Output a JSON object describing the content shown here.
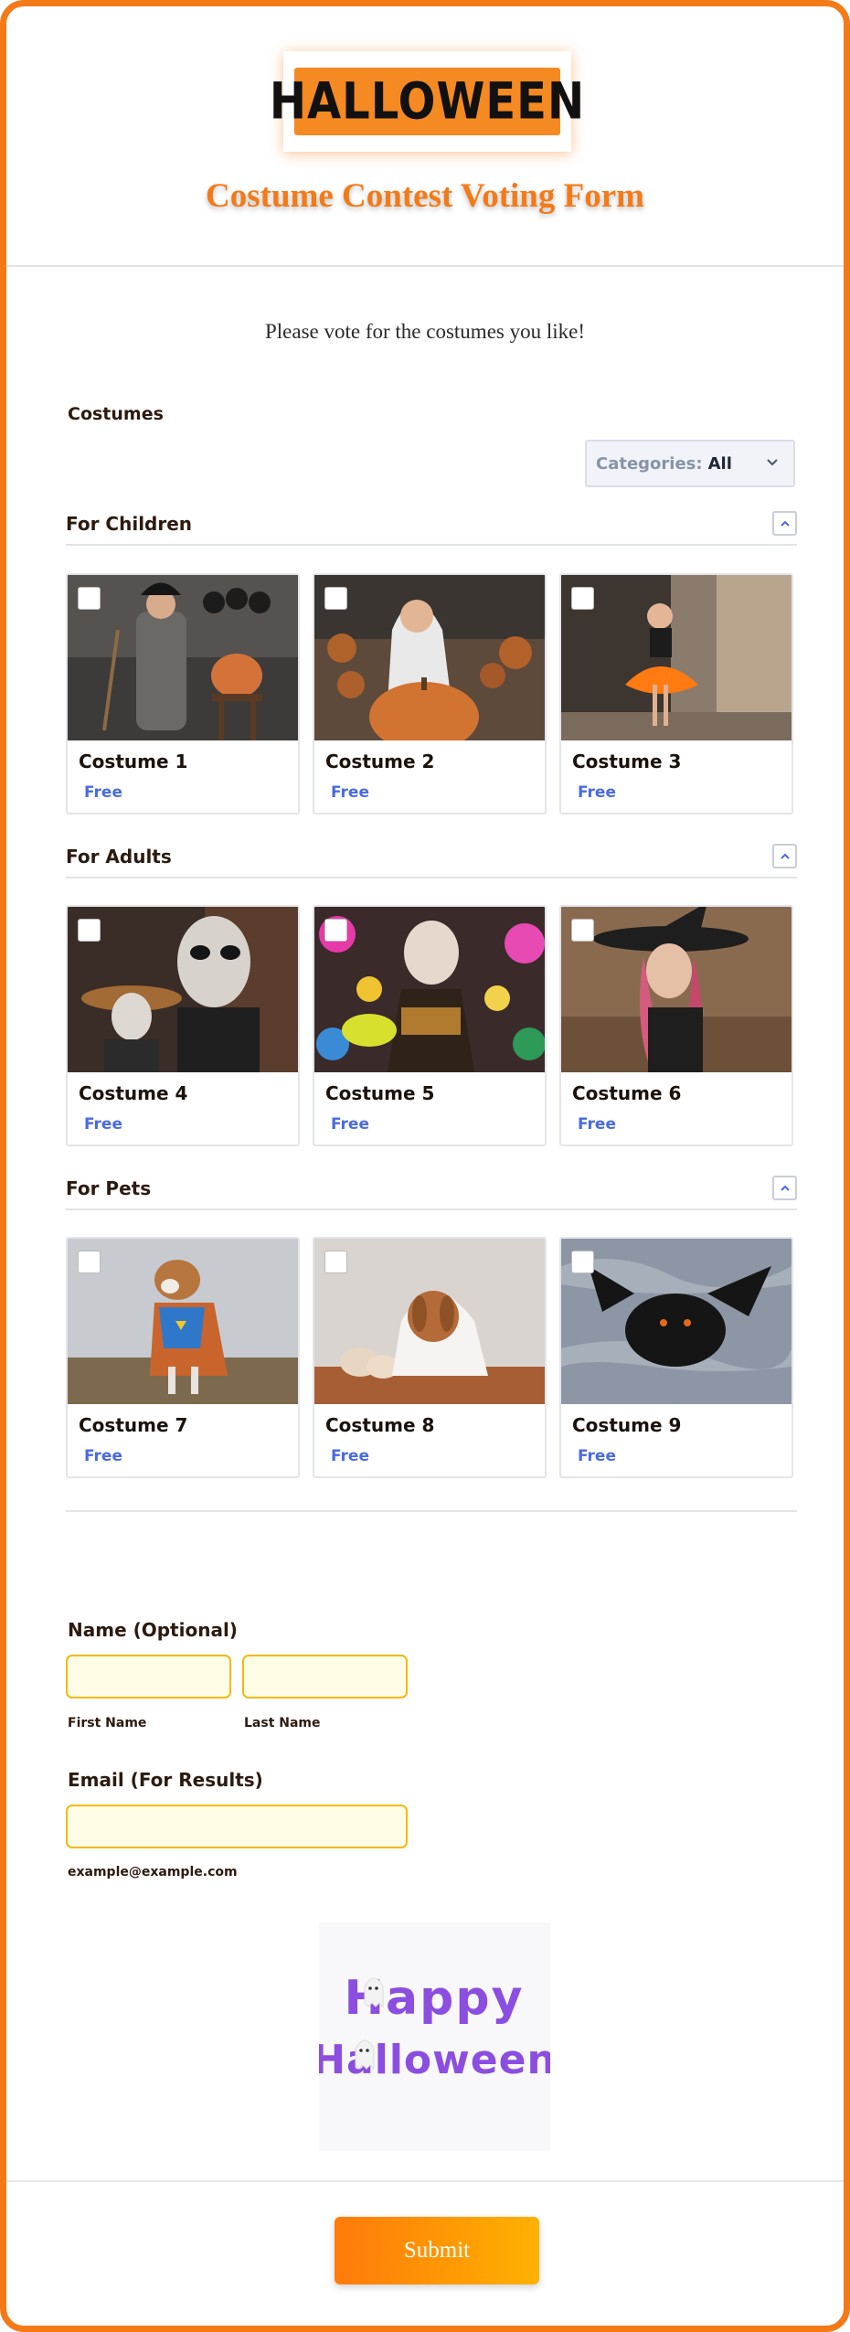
{
  "header": {
    "logo_text": "HALLOWEEN",
    "title": "Costume Contest Voting Form"
  },
  "intro": "Please vote for the costumes you like!",
  "costumes_label": "Costumes",
  "category_select": {
    "label": "Categories:",
    "value": "All"
  },
  "groups": [
    {
      "title": "For Children",
      "items": [
        {
          "name": "Costume 1",
          "price": "Free"
        },
        {
          "name": "Costume 2",
          "price": "Free"
        },
        {
          "name": "Costume 3",
          "price": "Free"
        }
      ]
    },
    {
      "title": "For Adults",
      "items": [
        {
          "name": "Costume 4",
          "price": "Free"
        },
        {
          "name": "Costume 5",
          "price": "Free"
        },
        {
          "name": "Costume 6",
          "price": "Free"
        }
      ]
    },
    {
      "title": "For Pets",
      "items": [
        {
          "name": "Costume 7",
          "price": "Free"
        },
        {
          "name": "Costume 8",
          "price": "Free"
        },
        {
          "name": "Costume 9",
          "price": "Free"
        }
      ]
    }
  ],
  "name_field": {
    "label": "Name (Optional)",
    "first": "First Name",
    "last": "Last Name"
  },
  "email_field": {
    "label": "Email (For Results)",
    "hint": "example@example.com"
  },
  "happy_halloween": {
    "line1": "Happy",
    "line2": "Halloween"
  },
  "submit_label": "Submit",
  "colors": {
    "accent": "#f47a18",
    "price": "#4a6ae0",
    "input_border": "#f5b80f",
    "input_bg": "#fffde6"
  }
}
